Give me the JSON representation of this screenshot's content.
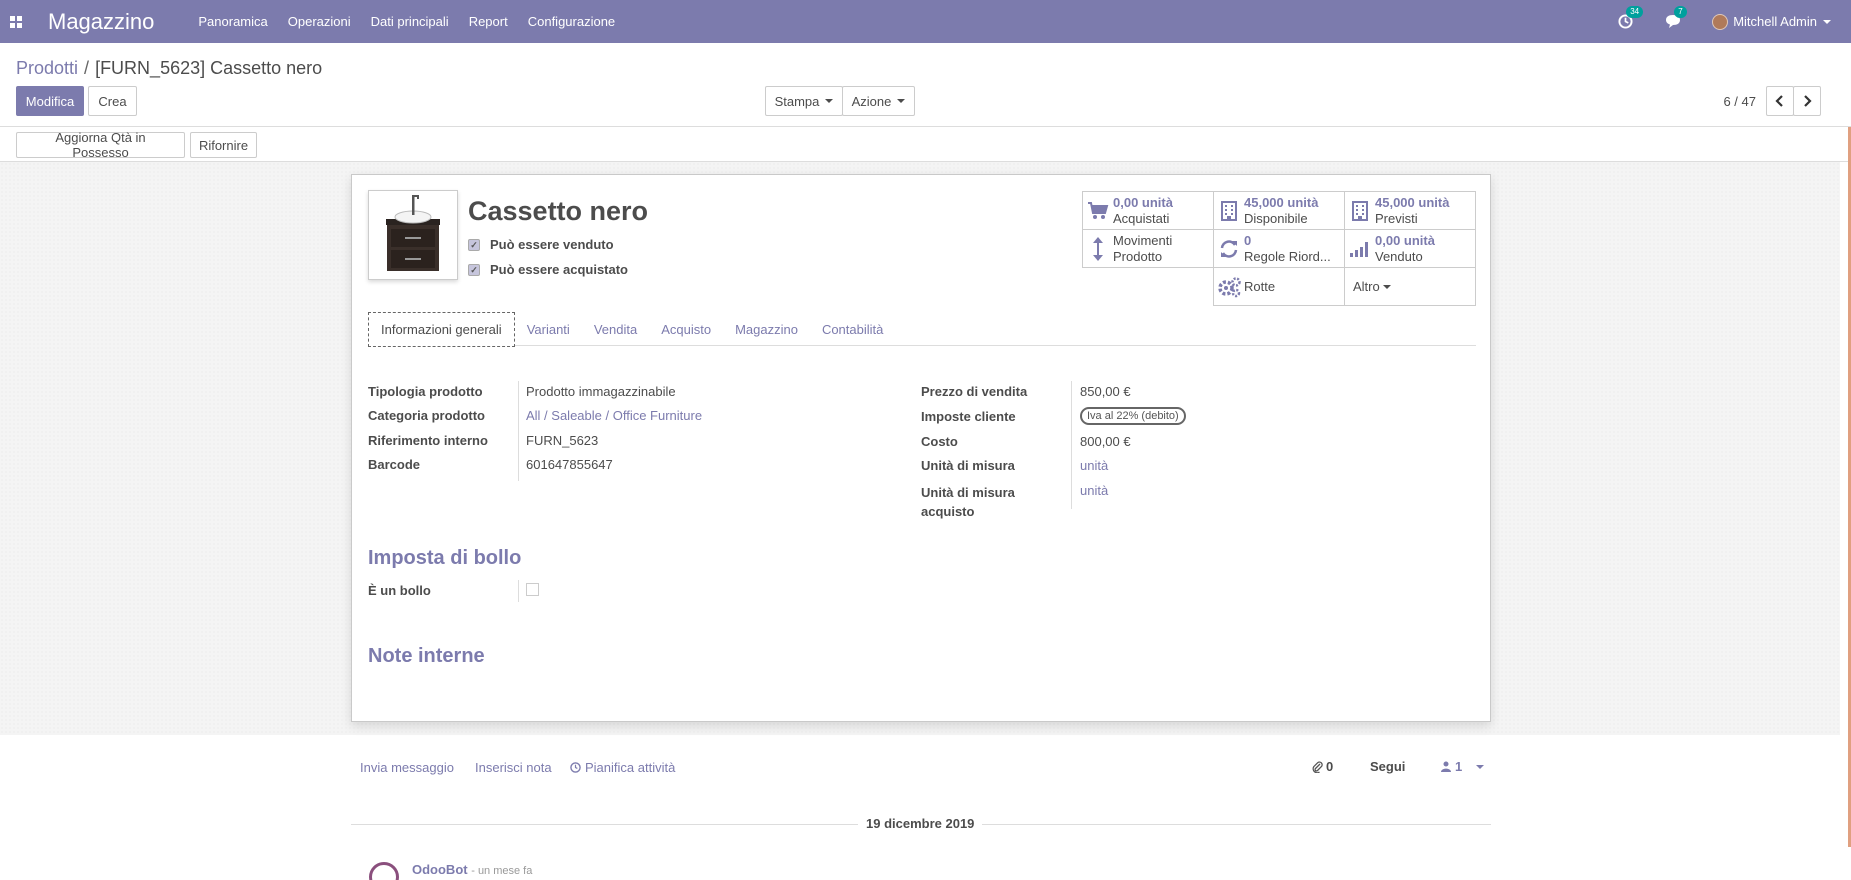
{
  "navbar": {
    "app_name": "Magazzino",
    "menu": [
      "Panoramica",
      "Operazioni",
      "Dati principali",
      "Report",
      "Configurazione"
    ],
    "activity_count": "34",
    "message_count": "7",
    "user_name": "Mitchell Admin",
    "color": "#7c7bad"
  },
  "breadcrumb": {
    "parent": "Prodotti",
    "separator": "/",
    "current": "[FURN_5623] Cassetto nero"
  },
  "toolbar": {
    "edit_label": "Modifica",
    "create_label": "Crea",
    "print_label": "Stampa",
    "action_label": "Azione",
    "pager_value": "6 / 47"
  },
  "statusbar": {
    "update_qty_label": "Aggiorna Qtà in Possesso",
    "replenish_label": "Rifornire"
  },
  "product": {
    "name": "Cassetto nero",
    "can_be_sold_label": "Può essere venduto",
    "can_be_purchased_label": "Può essere acquistato"
  },
  "stats": {
    "purchased": {
      "value": "0,00 unità",
      "label": "Acquistati"
    },
    "available": {
      "value": "45,000 unità",
      "label": "Disponibile"
    },
    "forecast": {
      "value": "45,000 unità",
      "label": "Previsti"
    },
    "moves": {
      "line1": "Movimenti",
      "line2": "Prodotto"
    },
    "reorder": {
      "value": "0",
      "label": "Regole Riord..."
    },
    "sold": {
      "value": "0,00 unità",
      "label": "Venduto"
    },
    "routes_label": "Rotte",
    "more_label": "Altro"
  },
  "tabs": [
    "Informazioni generali",
    "Varianti",
    "Vendita",
    "Acquisto",
    "Magazzino",
    "Contabilità"
  ],
  "general": {
    "product_type_label": "Tipologia prodotto",
    "product_type": "Prodotto immagazzinabile",
    "category_label": "Categoria prodotto",
    "category": "All / Saleable / Office Furniture",
    "internal_ref_label": "Riferimento interno",
    "internal_ref": "FURN_5623",
    "barcode_label": "Barcode",
    "barcode": "601647855647",
    "sale_price_label": "Prezzo di vendita",
    "sale_price": "850,00 €",
    "customer_taxes_label": "Imposte cliente",
    "customer_tax": "Iva al 22% (debito)",
    "cost_label": "Costo",
    "cost": "800,00 €",
    "uom_label": "Unità di misura",
    "uom": "unità",
    "purchase_uom_label_1": "Unità di misura",
    "purchase_uom_label_2": "acquisto",
    "purchase_uom": "unità"
  },
  "stamp_duty": {
    "title": "Imposta di bollo",
    "is_stamp_label": "È un bollo"
  },
  "notes": {
    "title": "Note interne"
  },
  "chatter": {
    "send_message": "Invia messaggio",
    "log_note": "Inserisci nota",
    "schedule_activity": "Pianifica attività",
    "attachments_count": "0",
    "follow_label": "Segui",
    "followers_count": "1",
    "date_separator": "19 dicembre 2019",
    "author": "OdooBot",
    "time": "- un mese fa"
  }
}
